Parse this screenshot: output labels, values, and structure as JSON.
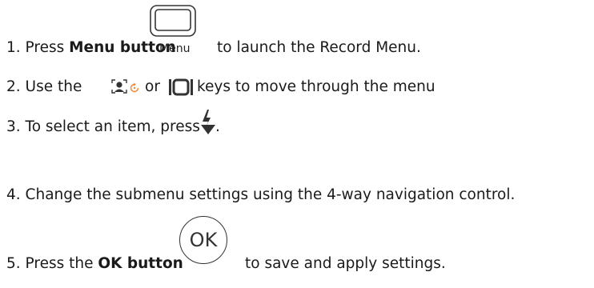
{
  "steps": [
    {
      "num": "1.",
      "pre": "Press ",
      "bold": "Menu button",
      "post": "to launch the Record Menu.",
      "icon_label": "Menu"
    },
    {
      "num": "2.",
      "pre": "Use the",
      "mid": "or",
      "post": "keys to move through the menu"
    },
    {
      "num": "3.",
      "pre": "To select an item, press",
      "post": "."
    },
    {
      "num": "4.",
      "text": "Change the submenu settings using the 4-way navigation control."
    },
    {
      "num": "5.",
      "pre": "Press the ",
      "bold": "OK button",
      "post": "to save and apply settings.",
      "icon_label": "OK"
    }
  ],
  "icons": [
    "menu-button-icon",
    "face-detect-icon",
    "rotate-icon",
    "display-mode-icon",
    "flash-icon",
    "ok-button-icon"
  ],
  "colors": {
    "text": "#1a1a1a",
    "icon_stroke": "#333333",
    "accent_icon": "#f08a3c"
  }
}
